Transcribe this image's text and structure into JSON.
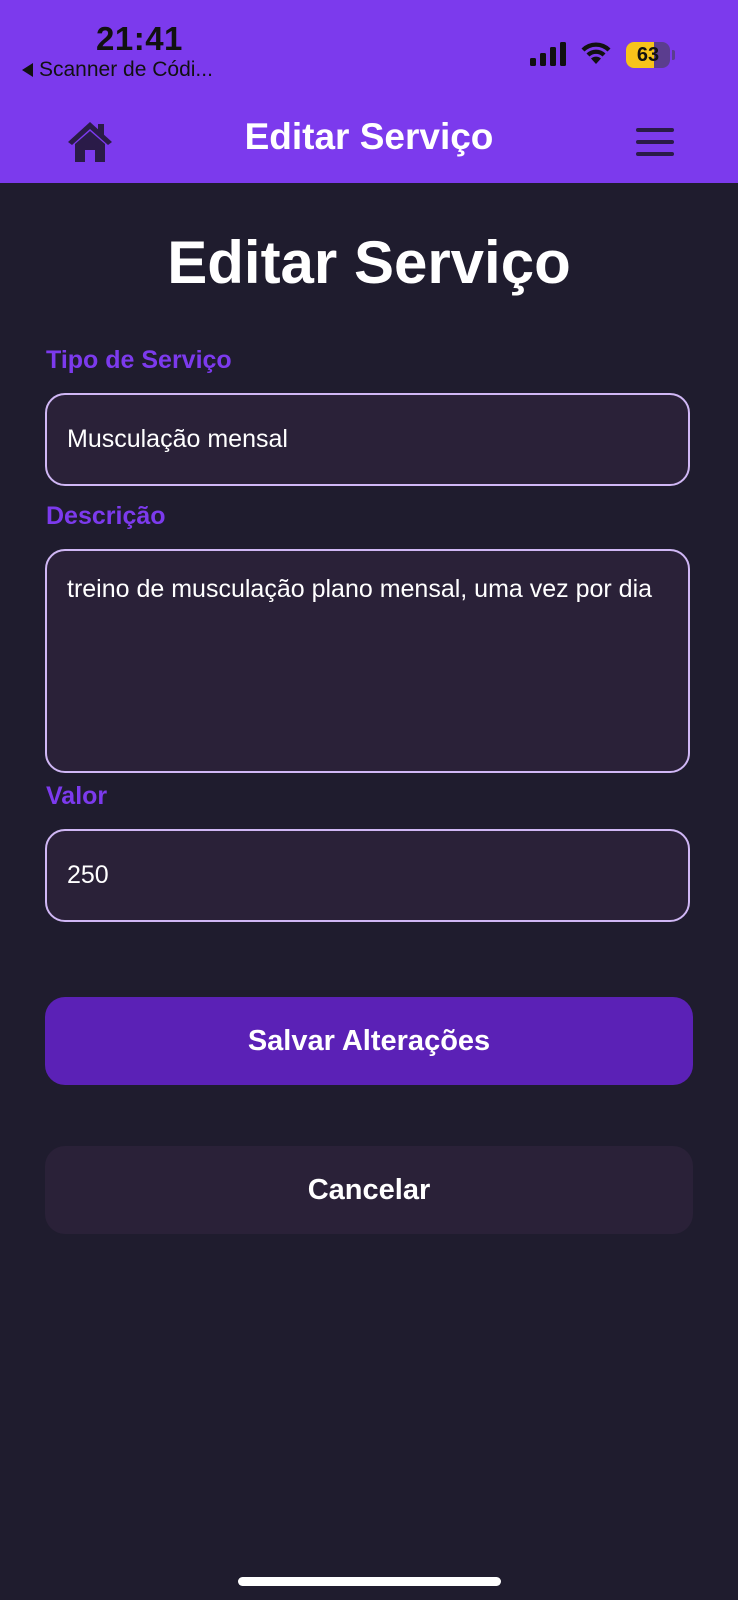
{
  "status_bar": {
    "time": "21:41",
    "back_label": "Scanner de Códi...",
    "battery_level": "63",
    "battery_fraction": 0.63
  },
  "header": {
    "title": "Editar Serviço",
    "home_icon": "home-icon",
    "menu_icon": "hamburger-menu-icon"
  },
  "page": {
    "title": "Editar Serviço"
  },
  "form": {
    "tipo": {
      "label": "Tipo de Serviço",
      "value": "Musculação mensal"
    },
    "descricao": {
      "label": "Descrição",
      "value": "treino de musculação plano mensal, uma vez por dia"
    },
    "valor": {
      "label": "Valor",
      "value": "250"
    }
  },
  "actions": {
    "save_label": "Salvar Alterações",
    "cancel_label": "Cancelar"
  },
  "colors": {
    "accent": "#7c3aed",
    "button_primary": "#5b21b6",
    "background": "#1f1c2e",
    "field_background": "#2a2138",
    "field_border": "#d0b7f5"
  }
}
